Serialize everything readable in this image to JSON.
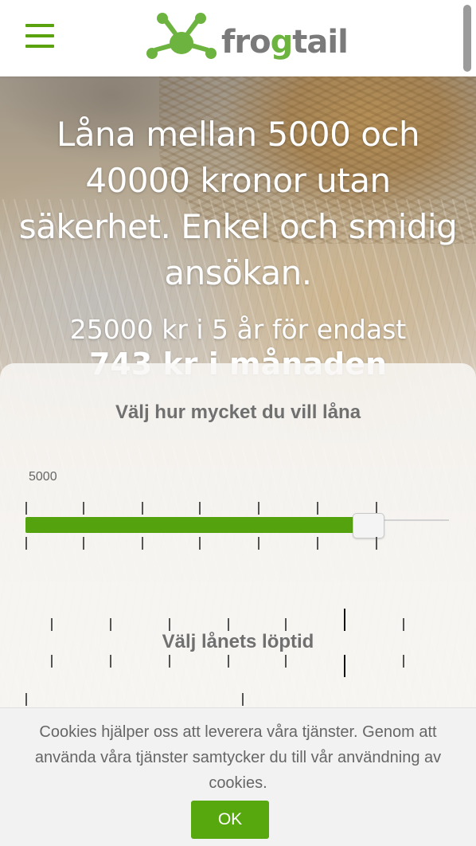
{
  "brand": {
    "name_prefix": "fro",
    "name_highlight": "g",
    "name_suffix": "tail",
    "accent": "#5aa30f",
    "logo_grey": "#7a7a7a"
  },
  "header": {
    "menu_icon": "hamburger-icon",
    "logo_icon": "frog-icon"
  },
  "hero": {
    "headline": "Låna mellan 5000 och 40000 kronor utan säkerhet. Enkel och smidig ansökan.",
    "subline": "25000 kr i 5 år för endast",
    "price": "743 kr i månaden"
  },
  "amount_slider": {
    "title": "Välj hur mycket du vill låna",
    "min_label": "5000",
    "min": 5000,
    "max": 40000,
    "value_fraction": 0.81
  },
  "term_slider": {
    "title": "Välj lånets löptid"
  },
  "cookie_bar": {
    "text": "Cookies hjälper oss att leverera våra tjänster. Genom att använda våra tjänster samtycker du till vår användning av cookies.",
    "ok_label": "OK"
  }
}
